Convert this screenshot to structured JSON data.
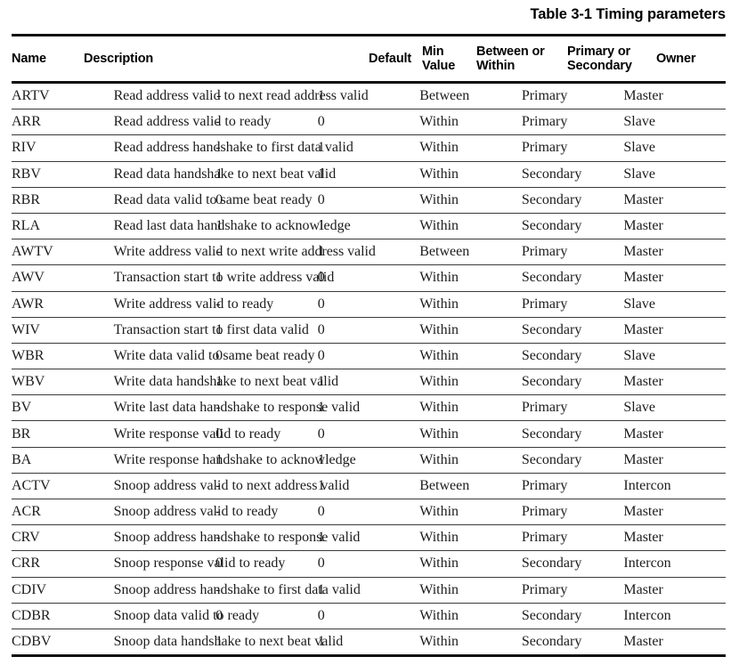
{
  "caption": "Table 3-1 Timing parameters",
  "table": {
    "columns": [
      {
        "key": "name",
        "label": "Name"
      },
      {
        "key": "desc",
        "label": "Description"
      },
      {
        "key": "default",
        "label": "Default"
      },
      {
        "key": "min",
        "label": "Min\nValue"
      },
      {
        "key": "bw",
        "label": "Between or\nWithin"
      },
      {
        "key": "ps",
        "label": "Primary or\nSecondary"
      },
      {
        "key": "owner",
        "label": "Owner"
      }
    ],
    "column_labels": {
      "name": "Name",
      "desc": "Description",
      "default": "Default",
      "min_line1": "Min",
      "min_line2": "Value",
      "bw_line1": "Between or",
      "bw_line2": "Within",
      "ps_line1": "Primary or",
      "ps_line2": "Secondary",
      "owner": "Owner"
    },
    "rows": [
      {
        "name": "ARTV",
        "desc": "Read address valid to next read address valid",
        "default": "-",
        "min": "1",
        "bw": "Between",
        "ps": "Primary",
        "owner": "Master"
      },
      {
        "name": "ARR",
        "desc": "Read address valid to ready",
        "default": "-",
        "min": "0",
        "bw": "Within",
        "ps": "Primary",
        "owner": "Slave"
      },
      {
        "name": "RIV",
        "desc": "Read address handshake to first data valid",
        "default": "-",
        "min": "1",
        "bw": "Within",
        "ps": "Primary",
        "owner": "Slave"
      },
      {
        "name": "RBV",
        "desc": "Read data handshake to next beat valid",
        "default": "1",
        "min": "1",
        "bw": "Within",
        "ps": "Secondary",
        "owner": "Slave"
      },
      {
        "name": "RBR",
        "desc": "Read data valid to same beat ready",
        "default": "0",
        "min": "0",
        "bw": "Within",
        "ps": "Secondary",
        "owner": "Master"
      },
      {
        "name": "RLA",
        "desc": "Read last data handshake to acknowledge",
        "default": "1",
        "min": "1",
        "bw": "Within",
        "ps": "Secondary",
        "owner": "Master"
      },
      {
        "name": "AWTV",
        "desc": "Write address valid to next write address valid",
        "default": "-",
        "min": "1",
        "bw": "Between",
        "ps": "Primary",
        "owner": "Master"
      },
      {
        "name": "AWV",
        "desc": "Transaction start to write address valid",
        "default": "1",
        "min": "0",
        "bw": "Within",
        "ps": "Secondary",
        "owner": "Master"
      },
      {
        "name": "AWR",
        "desc": "Write address valid to ready",
        "default": "-",
        "min": "0",
        "bw": "Within",
        "ps": "Primary",
        "owner": "Slave"
      },
      {
        "name": "WIV",
        "desc": "Transaction start to first data valid",
        "default": "1",
        "min": "0",
        "bw": "Within",
        "ps": "Secondary",
        "owner": "Master"
      },
      {
        "name": "WBR",
        "desc": "Write data valid to same beat ready",
        "default": "0",
        "min": "0",
        "bw": "Within",
        "ps": "Secondary",
        "owner": "Slave"
      },
      {
        "name": "WBV",
        "desc": "Write data handshake to next beat valid",
        "default": "1",
        "min": "1",
        "bw": "Within",
        "ps": "Secondary",
        "owner": "Master"
      },
      {
        "name": "BV",
        "desc": "Write last data handshake to response valid",
        "default": "-",
        "min": "1",
        "bw": "Within",
        "ps": "Primary",
        "owner": "Slave"
      },
      {
        "name": "BR",
        "desc": "Write response valid to ready",
        "default": "0",
        "min": "0",
        "bw": "Within",
        "ps": "Secondary",
        "owner": "Master"
      },
      {
        "name": "BA",
        "desc": "Write response handshake to acknowledge",
        "default": "1",
        "min": "1",
        "bw": "Within",
        "ps": "Secondary",
        "owner": "Master"
      },
      {
        "name": "ACTV",
        "desc": "Snoop address valid to next address valid",
        "default": "-",
        "min": "1",
        "bw": "Between",
        "ps": "Primary",
        "owner": "Intercon"
      },
      {
        "name": "ACR",
        "desc": "Snoop address valid to ready",
        "default": "-",
        "min": "0",
        "bw": "Within",
        "ps": "Primary",
        "owner": "Master"
      },
      {
        "name": "CRV",
        "desc": "Snoop address handshake to response valid",
        "default": "-",
        "min": "1",
        "bw": "Within",
        "ps": "Primary",
        "owner": "Master"
      },
      {
        "name": "CRR",
        "desc": "Snoop response valid to ready",
        "default": "0",
        "min": "0",
        "bw": "Within",
        "ps": "Secondary",
        "owner": "Intercon"
      },
      {
        "name": "CDIV",
        "desc": "Snoop address handshake to first data valid",
        "default": "-",
        "min": "1",
        "bw": "Within",
        "ps": "Primary",
        "owner": "Master"
      },
      {
        "name": "CDBR",
        "desc": "Snoop data valid to ready",
        "default": "0",
        "min": "0",
        "bw": "Within",
        "ps": "Secondary",
        "owner": "Intercon"
      },
      {
        "name": "CDBV",
        "desc": "Snoop data handshake to next beat valid",
        "default": "1",
        "min": "1",
        "bw": "Within",
        "ps": "Secondary",
        "owner": "Master"
      }
    ]
  },
  "colors": {
    "text": "#1c1c1c",
    "heading": "#000000",
    "rule_major": "#111111",
    "rule_minor": "#3a3a3a",
    "background": "#ffffff"
  }
}
